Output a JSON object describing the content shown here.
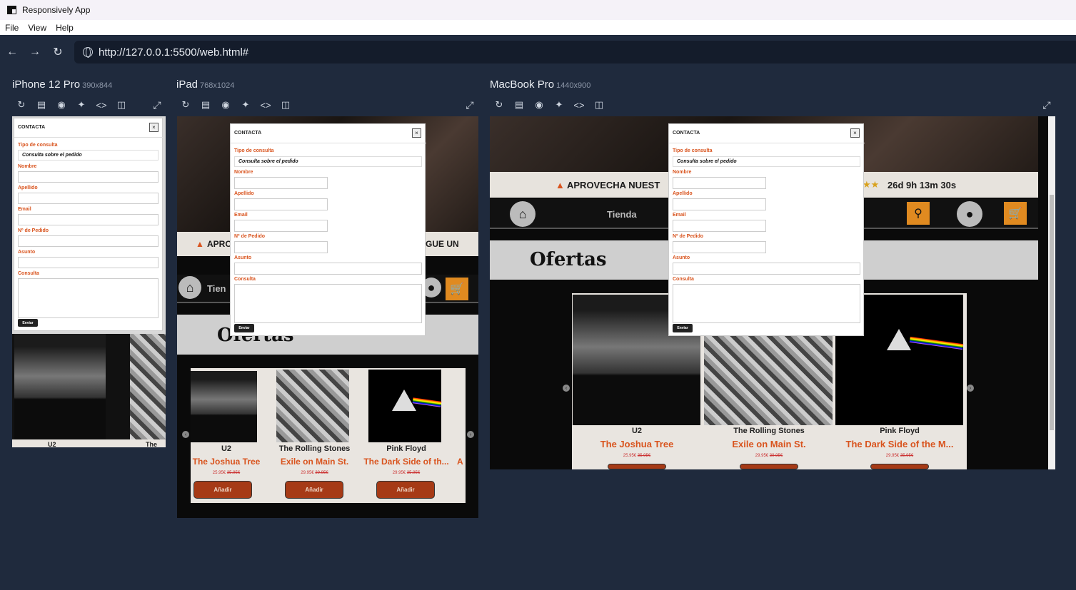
{
  "app": {
    "title": "Responsively App"
  },
  "menu": {
    "file": "File",
    "view": "View",
    "help": "Help"
  },
  "address": {
    "url": "http://127.0.0.1:5500/web.html#"
  },
  "devices": [
    {
      "name": "iPhone 12 Pro",
      "res": "390x844"
    },
    {
      "name": "iPad",
      "res": "768x1024"
    },
    {
      "name": "MacBook Pro",
      "res": "1440x900"
    }
  ],
  "site": {
    "banner_ipad_left": "APRO",
    "banner_ipad_right": "GUE UN",
    "banner_mac_left": "APROVECHA NUEST",
    "banner_mac_right": "26d 9h 13m 30s",
    "nav_tienda": "Tienda",
    "nav_tienda_ipad": "Tien",
    "ofertas": "Ofertas",
    "ofertas_ipad": "Ofertas",
    "products": [
      {
        "artist": "U2",
        "album": "The Joshua Tree",
        "price": "25.95€",
        "old": "35.95€"
      },
      {
        "artist": "The Rolling Stones",
        "album": "Exile on Main St.",
        "price": "29.95€",
        "old": "39.95€"
      },
      {
        "artist": "Pink Floyd",
        "album": "The Dark Side of the M...",
        "price": "29.95€",
        "old": "35.95€"
      }
    ],
    "iphone_product_artist": "U2",
    "iphone_product_artist_2": "The",
    "ipad_album_3": "The Dark Side of th...",
    "ipad_album_4": "A",
    "add_label": "Añadir"
  },
  "modal": {
    "title": "CONTACTA",
    "close": "×",
    "tipo_label": "Tipo de consulta",
    "tipo_value": "Consulta sobre el pedido",
    "nombre_label": "Nombre",
    "apellido_label": "Apellido",
    "email_label": "Email",
    "pedido_label": "Nº de Pedido",
    "asunto_label": "Asunto",
    "consulta_label": "Consulta",
    "send": "Enviar"
  },
  "colors": {
    "accent": "#d9541e",
    "background": "#1f2a3d",
    "urlbar": "#141c2b"
  }
}
